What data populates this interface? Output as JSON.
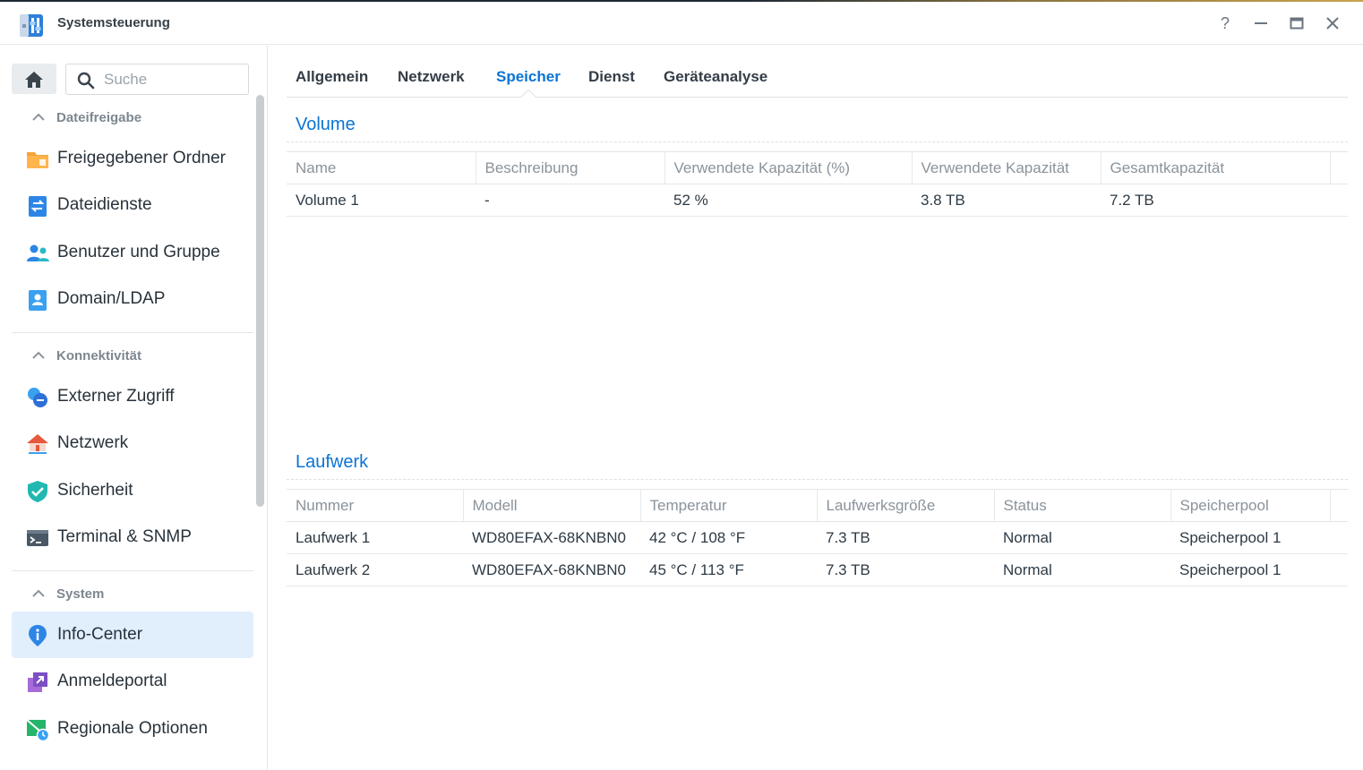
{
  "window": {
    "title": "Systemsteuerung",
    "help_label": "?",
    "minimize_label": "—",
    "maximize_label": "▭",
    "close_label": "✕"
  },
  "sidebar": {
    "search_placeholder": "Suche",
    "groups": [
      {
        "label": "Dateifreigabe",
        "items": [
          {
            "label": "Freigegebener Ordner",
            "icon": "folder-share-icon"
          },
          {
            "label": "Dateidienste",
            "icon": "file-services-icon"
          },
          {
            "label": "Benutzer und Gruppe",
            "icon": "users-icon"
          },
          {
            "label": "Domain/LDAP",
            "icon": "domain-ldap-icon"
          }
        ]
      },
      {
        "label": "Konnektivität",
        "items": [
          {
            "label": "Externer Zugriff",
            "icon": "external-access-icon"
          },
          {
            "label": "Netzwerk",
            "icon": "network-house-icon"
          },
          {
            "label": "Sicherheit",
            "icon": "shield-check-icon"
          },
          {
            "label": "Terminal & SNMP",
            "icon": "terminal-icon"
          }
        ]
      },
      {
        "label": "System",
        "items": [
          {
            "label": "Info-Center",
            "icon": "info-pin-icon",
            "active": true
          },
          {
            "label": "Anmeldeportal",
            "icon": "login-portal-icon"
          },
          {
            "label": "Regionale Optionen",
            "icon": "regional-options-icon"
          }
        ]
      }
    ]
  },
  "tabs": [
    {
      "label": "Allgemein"
    },
    {
      "label": "Netzwerk"
    },
    {
      "label": "Speicher",
      "active": true
    },
    {
      "label": "Dienst"
    },
    {
      "label": "Geräteanalyse"
    }
  ],
  "volume": {
    "title": "Volume",
    "columns": [
      "Name",
      "Beschreibung",
      "Verwendete Kapazität (%)",
      "Verwendete Kapazität",
      "Gesamtkapazität"
    ],
    "rows": [
      [
        "Volume 1",
        "-",
        "52 %",
        "3.8 TB",
        "7.2 TB"
      ]
    ]
  },
  "drives": {
    "title": "Laufwerk",
    "columns": [
      "Nummer",
      "Modell",
      "Temperatur",
      "Laufwerksgröße",
      "Status",
      "Speicherpool"
    ],
    "rows": [
      [
        "Laufwerk 1",
        "WD80EFAX-68KNBN0",
        "42 °C / 108 °F",
        "7.3 TB",
        "Normal",
        "Speicherpool 1"
      ],
      [
        "Laufwerk 2",
        "WD80EFAX-68KNBN0",
        "45 °C / 113 °F",
        "7.3 TB",
        "Normal",
        "Speicherpool 1"
      ]
    ]
  },
  "colors": {
    "accent": "#0a74d4",
    "status_normal": "#1ca83c",
    "active_nav_bg": "#e1eefc"
  }
}
